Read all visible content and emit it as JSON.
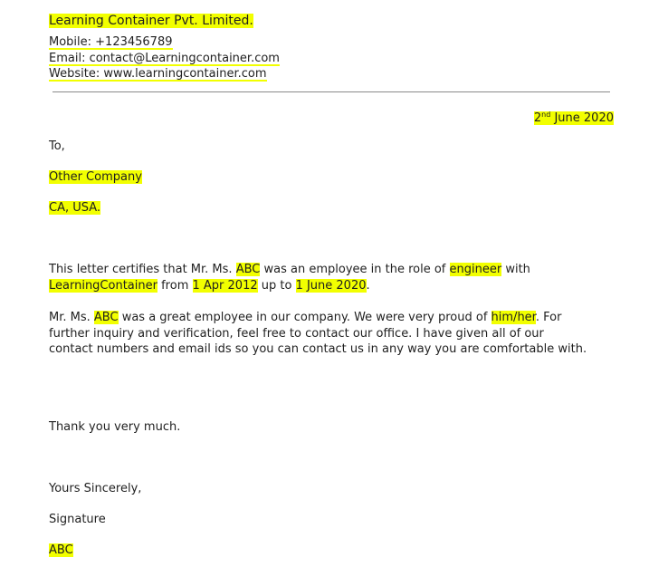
{
  "header": {
    "company_name": "Learning Container Pvt. Limited.",
    "mobile": "Mobile: +123456789",
    "email": "Email: contact@Learningcontainer.com",
    "website": "Website: www.learningcontainer.com"
  },
  "date": {
    "day": "2",
    "suffix": "nd",
    "rest": " June 2020"
  },
  "recipient": {
    "salutation": "To,",
    "company": "Other Company",
    "location": "CA, USA."
  },
  "body": {
    "p1": {
      "t1": "This letter certifies that Mr. Ms. ",
      "name": "ABC",
      "t2": " was an employee in the role of ",
      "role": "engineer",
      "t3": " with ",
      "employer": "LearningContainer",
      "t4": " from ",
      "start_date": "1 Apr 2012",
      "t5": " up to ",
      "end_date": "1 June 2020",
      "t6": "."
    },
    "p2": {
      "t1": "Mr. Ms. ",
      "name": "ABC",
      "t2": " was a great employee in our company. We were very proud of ",
      "pronoun": "him/her",
      "t3": ". For further inquiry and verification, feel free to contact our office. I have given all of our contact numbers and email ids so you can contact us in any way you are comfortable with."
    },
    "thanks": "Thank you very much."
  },
  "closing": {
    "valediction": "Yours Sincerely,",
    "signature": "Signature",
    "signer": "ABC"
  },
  "colors": {
    "highlight": "#f2ff00",
    "text": "#1f1f1f",
    "divider": "#8a8a8a"
  }
}
